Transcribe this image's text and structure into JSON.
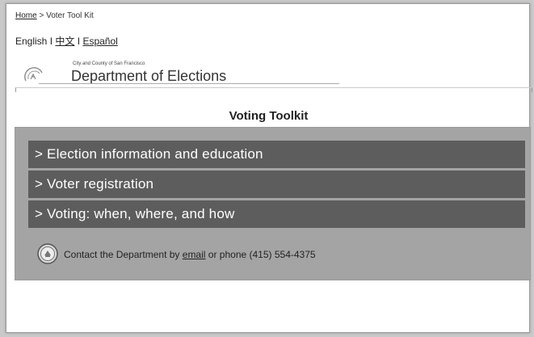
{
  "breadcrumb": {
    "home": "Home",
    "separator": ">",
    "current": "Voter Tool Kit"
  },
  "languages": {
    "english": "English",
    "sep1": "I",
    "chinese": "中文",
    "sep2": "I",
    "spanish": "Español"
  },
  "header": {
    "city_line": "City and County of San Francisco",
    "department": "Department of Elections",
    "logo_icon": "city-seal-icon"
  },
  "page": {
    "title": "Voting Toolkit"
  },
  "menu": {
    "items": [
      {
        "label": "> Election information and education"
      },
      {
        "label": "> Voter registration"
      },
      {
        "label": "> Voting: when, where, and how"
      }
    ]
  },
  "contact": {
    "icon": "seal-icon",
    "prefix": "Contact the Department by",
    "email_link": "email",
    "suffix": "or phone (415) 554-4375"
  },
  "colors": {
    "panel_bg": "#a4a4a4",
    "menu_bg": "#5d5d5d",
    "menu_text": "#ffffff"
  }
}
